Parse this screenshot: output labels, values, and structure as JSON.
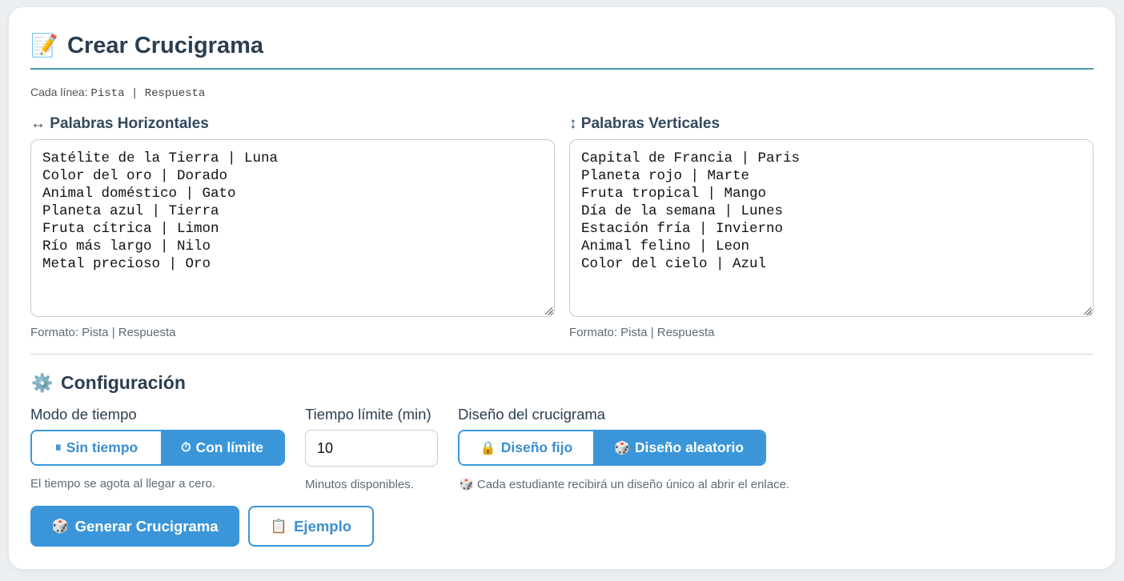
{
  "header": {
    "icon": "memo-icon",
    "icon_glyph": "📝",
    "title": "Crear Crucigrama"
  },
  "hint": {
    "prefix": "Cada línea:",
    "code": "Pista  |  Respuesta"
  },
  "horizontal": {
    "icon_glyph": "↔",
    "label": "Palabras Horizontales",
    "value": "Satélite de la Tierra | Luna\nColor del oro | Dorado\nAnimal doméstico | Gato\nPlaneta azul | Tierra\nFruta cítrica | Limon\nRío más largo | Nilo\nMetal precioso | Oro",
    "format": "Formato: Pista | Respuesta"
  },
  "vertical": {
    "icon_glyph": "↕",
    "label": "Palabras Verticales",
    "value": "Capital de Francia | Paris\nPlaneta rojo | Marte\nFruta tropical | Mango\nDía de la semana | Lunes\nEstación fría | Invierno\nAnimal felino | Leon\nColor del cielo | Azul",
    "format": "Formato: Pista | Respuesta"
  },
  "config": {
    "icon_glyph": "⚙️",
    "title": "Configuración",
    "time_mode": {
      "label": "Modo de tiempo",
      "options": [
        {
          "icon": "pause-icon",
          "glyph": "⏸",
          "label": "Sin tiempo",
          "active": false
        },
        {
          "icon": "timer-icon",
          "glyph": "⏱",
          "label": "Con límite",
          "active": true
        }
      ],
      "help": "El tiempo se agota al llegar a cero."
    },
    "time_limit": {
      "label": "Tiempo límite (min)",
      "value": "10",
      "help": "Minutos disponibles."
    },
    "design": {
      "label": "Diseño del crucigrama",
      "options": [
        {
          "icon": "lock-icon",
          "glyph": "🔒",
          "label": "Diseño fijo",
          "active": false
        },
        {
          "icon": "dice-icon",
          "glyph": "🎲",
          "label": "Diseño aleatorio",
          "active": true
        }
      ],
      "help_glyph": "🎲",
      "help": "Cada estudiante recibirá un diseño único al abrir el enlace."
    }
  },
  "actions": {
    "generate": {
      "glyph": "🎲",
      "label": "Generar Crucigrama"
    },
    "example": {
      "glyph": "📋",
      "label": "Ejemplo"
    }
  },
  "colors": {
    "accent": "#3a96d8",
    "header_rule": "#4a9aa5",
    "background": "#eceff1"
  }
}
